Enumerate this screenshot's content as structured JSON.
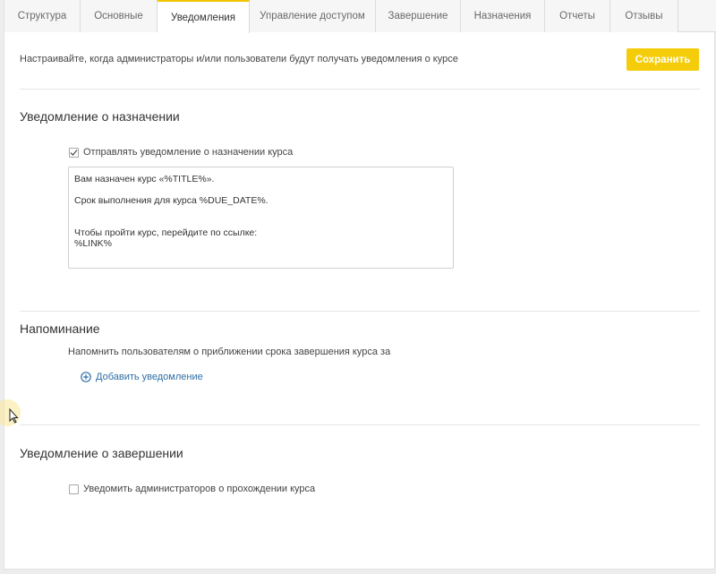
{
  "tabs": [
    {
      "label": "Структура"
    },
    {
      "label": "Основные"
    },
    {
      "label": "Уведомления"
    },
    {
      "label": "Управление доступом"
    },
    {
      "label": "Завершение"
    },
    {
      "label": "Назначения"
    },
    {
      "label": "Отчеты"
    },
    {
      "label": "Отзывы"
    }
  ],
  "active_tab": "Уведомления",
  "header": {
    "info": "Настраивайте, когда администраторы и/или пользователи будут получать уведомления о курсе",
    "save_label": "Сохранить"
  },
  "assignment": {
    "title": "Уведомление о назначении",
    "checkbox_label": "Отправлять уведомление о назначении курса",
    "checked": true,
    "message_lines": [
      "Вам назначен курс «%TITLE%».",
      "",
      "Срок выполнения для курса %DUE_DATE%.",
      "",
      "",
      "Чтобы пройти курс, перейдите по ссылке:",
      "%LINK%"
    ]
  },
  "reminder": {
    "title": "Напоминание",
    "description": "Напомнить пользователям о приближении срока завершения курса за",
    "add_label": "Добавить уведомление"
  },
  "completion": {
    "title": "Уведомление о завершении",
    "checkbox_label": "Уведомить администраторов о прохождении курса",
    "checked": false
  },
  "colors": {
    "accent": "#f5cc0a",
    "link": "#2e6ea6"
  }
}
